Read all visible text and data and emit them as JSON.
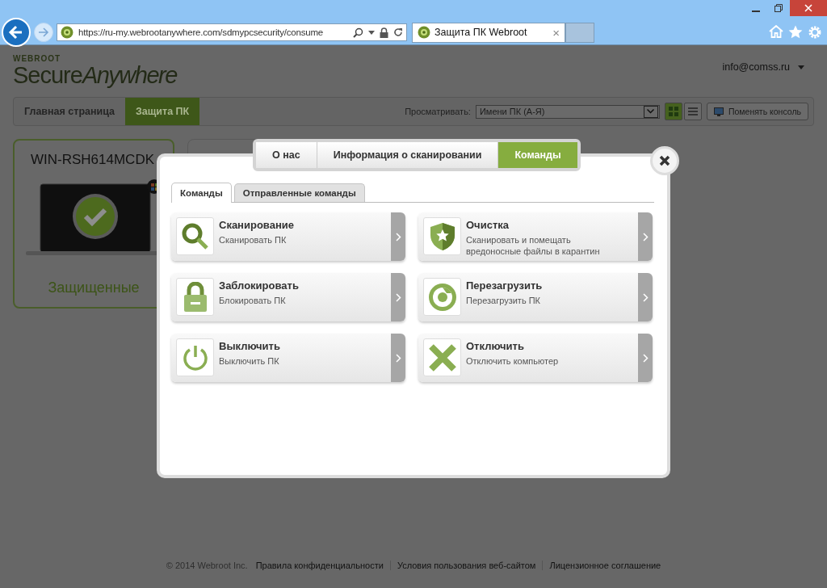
{
  "browser": {
    "address": "https://ru-my.webrootanywhere.com/sdmypcsecurity/consume",
    "tab_title": "Защита ПК Webroot",
    "tab_close": "×"
  },
  "header": {
    "brand_small": "WEBROOT",
    "brand_bold": "Secure",
    "brand_italic": "Anywhere",
    "account": "info@comss.ru"
  },
  "nav": {
    "tabs": [
      {
        "label": "Главная страница",
        "selected": false
      },
      {
        "label": "Защита ПК",
        "selected": true
      }
    ],
    "sort_label": "Просматривать:",
    "sort_value": "Имени ПК (А-Я)",
    "views": [
      {
        "kind": "grid",
        "selected": true
      },
      {
        "kind": "list",
        "selected": false
      }
    ],
    "console_button": "Поменять консоль"
  },
  "device": {
    "name": "WIN-RSH614MCDK",
    "status": "Защищенные"
  },
  "modal": {
    "tabs": [
      {
        "label": "О нас",
        "selected": false
      },
      {
        "label": "Информация о сканировании",
        "selected": false
      },
      {
        "label": "Команды",
        "selected": true
      }
    ],
    "subtabs": [
      {
        "label": "Команды",
        "selected": true
      },
      {
        "label": "Отправленные команды",
        "selected": false
      }
    ],
    "commands": [
      {
        "kind": "search",
        "title": "Сканирование",
        "desc": "Сканировать ПК"
      },
      {
        "kind": "shield",
        "title": "Очистка",
        "desc": "Сканировать и помещать вредоносные файлы в карантин"
      },
      {
        "kind": "lock",
        "title": "Заблокировать",
        "desc": "Блокировать ПК"
      },
      {
        "kind": "restart",
        "title": "Перезагрузить",
        "desc": "Перезагрузить ПК"
      },
      {
        "kind": "power",
        "title": "Выключить",
        "desc": "Выключить ПК"
      },
      {
        "kind": "cross",
        "title": "Отключить",
        "desc": "Отключить компьютер"
      }
    ]
  },
  "footer": {
    "copyright": "© 2014 Webroot Inc.",
    "links": [
      "Правила конфиденциальности",
      "Условия пользования веб-сайтом",
      "Лицензионное соглашение"
    ]
  }
}
